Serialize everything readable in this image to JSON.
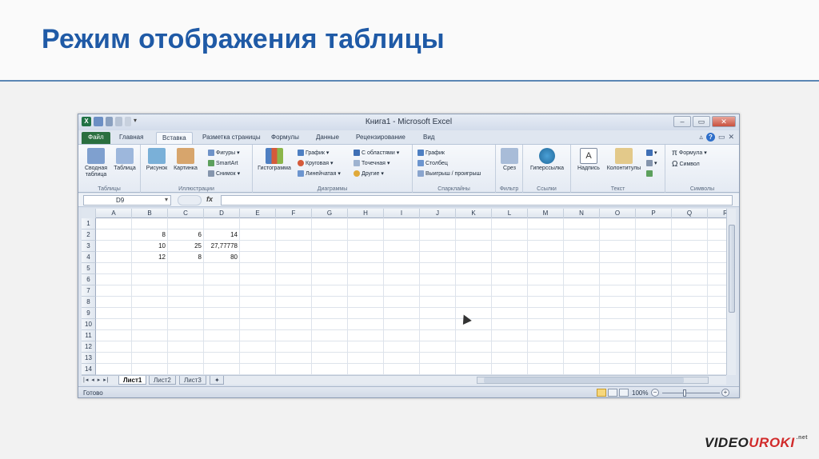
{
  "slide": {
    "title": "Режим отображения таблицы"
  },
  "excel": {
    "window_title": "Книга1 - Microsoft Excel",
    "tabs": [
      "Файл",
      "Главная",
      "Вставка",
      "Разметка страницы",
      "Формулы",
      "Данные",
      "Рецензирование",
      "Вид"
    ],
    "active_tab": "Вставка",
    "ribbon": {
      "groups": [
        {
          "label": "Таблицы",
          "buttons": [
            "Сводная таблица",
            "Таблица"
          ]
        },
        {
          "label": "Иллюстрации",
          "buttons": [
            "Рисунок",
            "Картинка"
          ],
          "small": [
            "Фигуры",
            "SmartArt",
            "Снимок"
          ]
        },
        {
          "label": "Диаграммы",
          "buttons": [
            "Гистограмма"
          ],
          "small": [
            "График",
            "Круговая",
            "Линейчатая",
            "С областями",
            "Точечная",
            "Другие"
          ]
        },
        {
          "label": "Спарклайны",
          "small": [
            "График",
            "Столбец",
            "Выигрыш / проигрыш"
          ]
        },
        {
          "label": "Фильтр",
          "buttons": [
            "Срез"
          ]
        },
        {
          "label": "Ссылки",
          "buttons": [
            "Гиперссылка"
          ]
        },
        {
          "label": "Текст",
          "buttons": [
            "Надпись",
            "Колонтитулы"
          ]
        },
        {
          "label": "Символы",
          "small": [
            "Формула",
            "Символ"
          ]
        }
      ]
    },
    "name_box": "D9",
    "fx_label": "fx",
    "columns": [
      "A",
      "B",
      "C",
      "D",
      "E",
      "F",
      "G",
      "H",
      "I",
      "J",
      "K",
      "L",
      "M",
      "N",
      "O",
      "P",
      "Q",
      "R"
    ],
    "rows": [
      "1",
      "2",
      "3",
      "4",
      "5",
      "6",
      "7",
      "8",
      "9",
      "10",
      "11",
      "12",
      "13",
      "14"
    ],
    "cells": [
      {
        "row": 2,
        "col": "B",
        "value": "8"
      },
      {
        "row": 2,
        "col": "C",
        "value": "6"
      },
      {
        "row": 2,
        "col": "D",
        "value": "14"
      },
      {
        "row": 3,
        "col": "B",
        "value": "10"
      },
      {
        "row": 3,
        "col": "C",
        "value": "25"
      },
      {
        "row": 3,
        "col": "D",
        "value": "27,77778"
      },
      {
        "row": 4,
        "col": "B",
        "value": "12"
      },
      {
        "row": 4,
        "col": "C",
        "value": "8"
      },
      {
        "row": 4,
        "col": "D",
        "value": "80"
      }
    ],
    "sheets": [
      "Лист1",
      "Лист2",
      "Лист3"
    ],
    "active_sheet": "Лист1",
    "status": "Готово",
    "zoom": "100%"
  },
  "brand": {
    "video": "VIDEO",
    "uroki": "UROKI",
    "net": ".net"
  }
}
